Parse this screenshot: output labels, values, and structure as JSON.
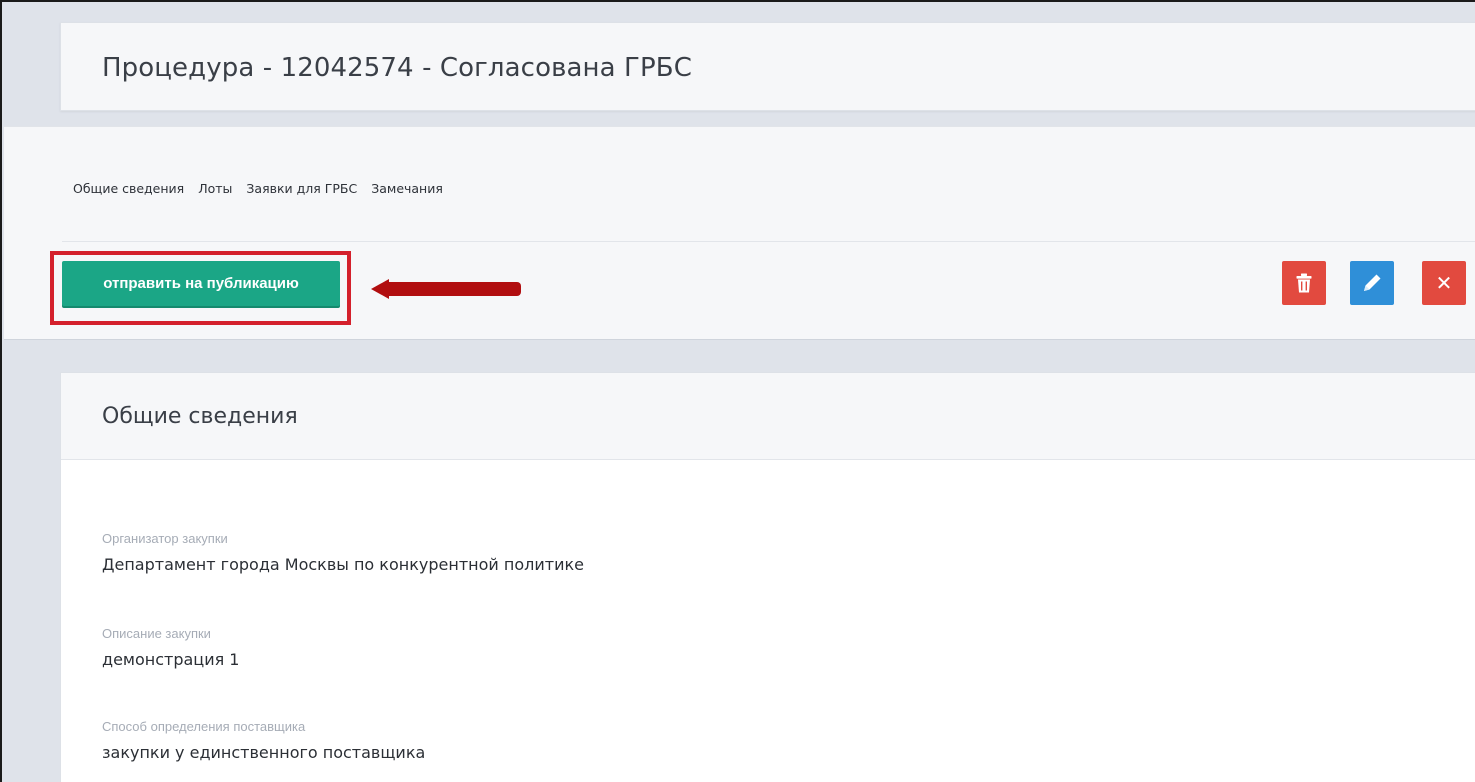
{
  "header": {
    "title": "Процедура - 12042574 - Согласована ГРБС"
  },
  "tabs": [
    {
      "label": "Общие сведения"
    },
    {
      "label": "Лоты"
    },
    {
      "label": "Заявки для ГРБС"
    },
    {
      "label": "Замечания"
    }
  ],
  "toolbar": {
    "publish_label": "отправить на публикацию",
    "delete_icon": "trash-icon",
    "edit_icon": "pencil-icon",
    "close_icon": "close-icon",
    "close_glyph": "✕"
  },
  "colors": {
    "publish": "#1ba686",
    "delete": "#e24a3f",
    "edit": "#2f8fd8",
    "highlight": "#d4202c",
    "arrow": "#b10e10"
  },
  "details": {
    "title": "Общие сведения",
    "fields": [
      {
        "label": "Организатор закупки",
        "value": "Департамент города Москвы по конкурентной политике"
      },
      {
        "label": "Описание закупки",
        "value": "демонстрация 1"
      },
      {
        "label": "Способ определения поставщика",
        "value": "закупки у единственного поставщика"
      }
    ]
  }
}
